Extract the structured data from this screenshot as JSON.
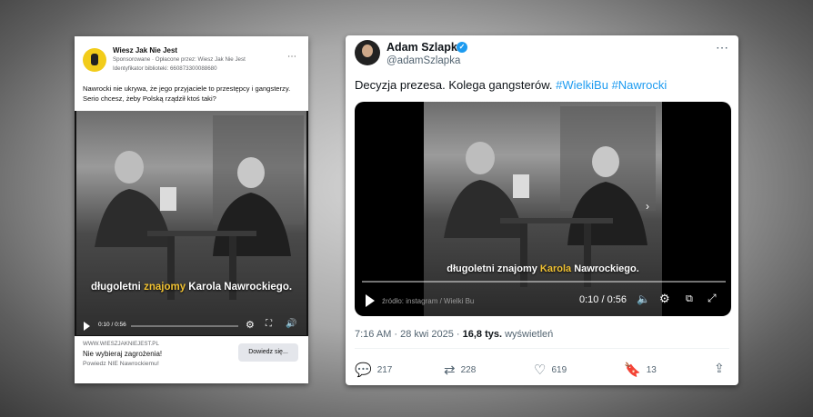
{
  "facebook_ad": {
    "page_name": "Wiesz Jak Nie Jest",
    "sponsored_line": "Sponsorowane · Opłacone przez: Wiesz Jak Nie Jest",
    "library_id": "Identyfikator biblioteki: 660873300088680",
    "more_icon": "⋯",
    "post_text_line1": "Nawrocki nie ukrywa, że jego przyjaciele to przestępcy i gangsterzy.",
    "post_text_line2": "Serio chcesz, żeby Polską rządził ktoś taki?",
    "video": {
      "caption_pre": "długoletni",
      "caption_highlight": "znajomy",
      "caption_post": "Karola Nawrockiego.",
      "time": "0:10 / 0:56",
      "play_icon": "play-icon",
      "settings_icon": "⚙",
      "fullscreen_icon": "⛶",
      "volume_icon": "🔊"
    },
    "link_url": "WWW.WIESZJAKNIEJEST.PL",
    "link_headline": "Nie wybieraj zagrożenia!",
    "link_description": "Powiedz NIE Nawrockiemu!",
    "cta_label": "Dowiedz się..."
  },
  "tweet": {
    "display_name": "Adam Szlapka",
    "handle": "@adamSzlapka",
    "verified_icon": "✓",
    "more_icon": "⋯",
    "text": "Decyzja prezesa. Kolega gangsterów.",
    "hashtag1": "#WielkiBu",
    "hashtag2": "#Nawrocki",
    "video": {
      "caption_pre": "długoletni",
      "caption_highlight": "znajomy",
      "caption_highlight2": "Karola",
      "caption_post": "Nawrockiego.",
      "source_text": "źródło: instagram / Wielki Bu",
      "time": "0:10 / 0:56",
      "volume_icon": "🔈",
      "settings_icon": "⚙",
      "pip_icon": "⧉",
      "expand_icon": "⤢",
      "next_icon": "›"
    },
    "timestamp": "7:16 AM · 28 kwi 2025 · ",
    "views_count": "16,8 tys.",
    "views_label": " wyświetleń",
    "actions": {
      "reply_icon": "💬",
      "reply_count": "217",
      "retweet_icon": "⇄",
      "retweet_count": "228",
      "like_icon": "♡",
      "like_count": "619",
      "bookmark_icon": "🔖",
      "bookmark_count": "13",
      "share_icon": "⇪"
    }
  },
  "colors": {
    "twitter_blue": "#1d9bf0",
    "caption_highlight": "#f1c232",
    "fb_logo": "#f2cc1a"
  }
}
